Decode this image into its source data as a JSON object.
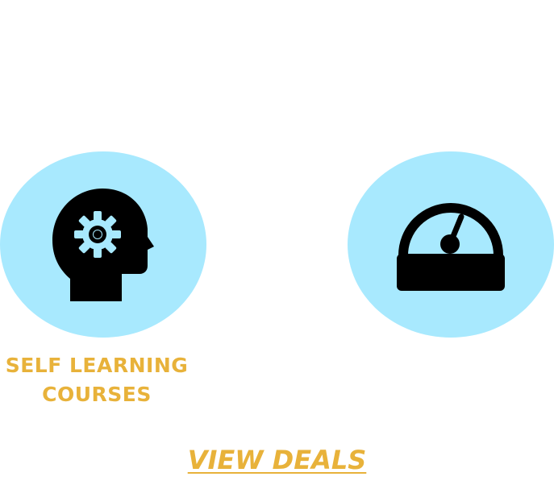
{
  "colors": {
    "circle_fill": "#a8e9fe",
    "accent_yellow": "#e8b23a",
    "icon_black": "#000000",
    "background": "#ffffff"
  },
  "cards": [
    {
      "icon": "head-gear-icon",
      "label_lines": [
        "SELF LEARNING",
        "COURSES"
      ]
    },
    {
      "icon": "speedometer-icon",
      "label_lines": []
    }
  ],
  "cta": {
    "label": "VIEW DEALS"
  }
}
